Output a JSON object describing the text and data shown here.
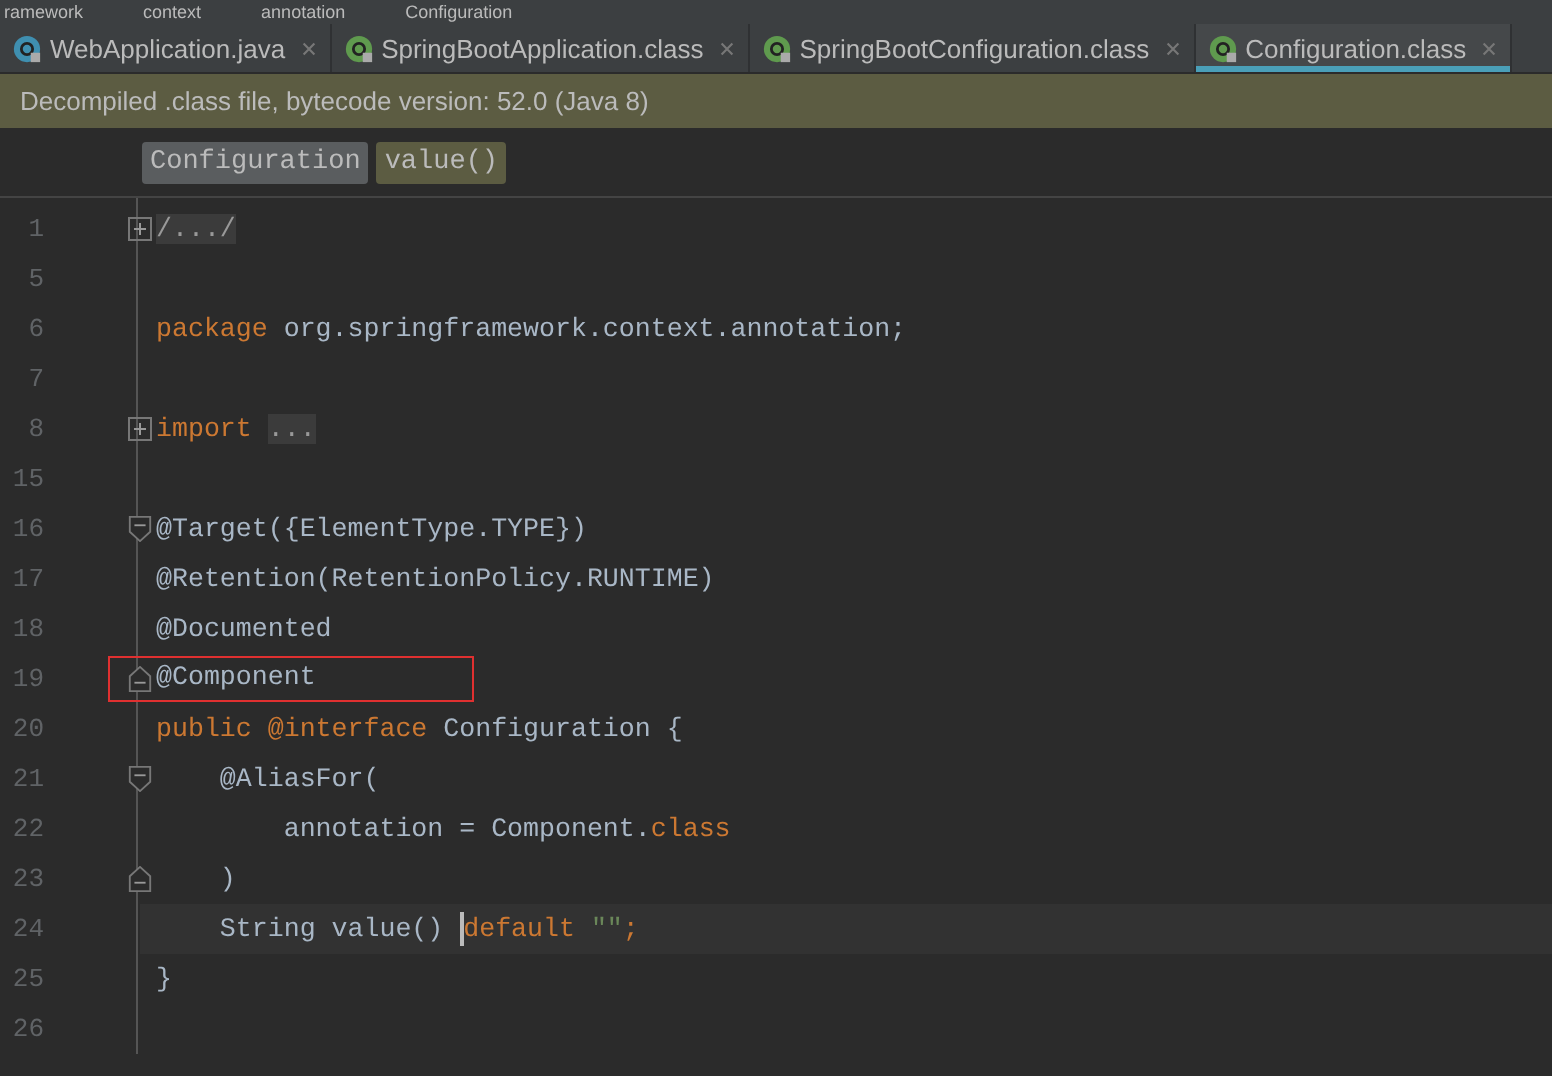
{
  "breadcrumbs": [
    "ramework",
    "context",
    "annotation",
    "Configuration"
  ],
  "tabs": [
    {
      "label": "WebApplication.java",
      "kind": "java",
      "selected": false
    },
    {
      "label": "SpringBootApplication.class",
      "kind": "class",
      "selected": false
    },
    {
      "label": "SpringBootConfiguration.class",
      "kind": "class",
      "selected": false
    },
    {
      "label": "Configuration.class",
      "kind": "class",
      "selected": true
    }
  ],
  "notice": "Decompiled .class file, bytecode version: 52.0 (Java 8)",
  "structure": [
    {
      "label": "Configuration",
      "selected": true
    },
    {
      "label": "value()",
      "selected": false
    }
  ],
  "lines": [
    {
      "number": "1",
      "collapsed": true,
      "fold_start": false,
      "fold_end": false,
      "current": false,
      "marked": false,
      "tokens": [
        {
          "kind": "folded",
          "text": "/.../"
        }
      ]
    },
    {
      "number": "5",
      "collapsed": false,
      "fold_start": false,
      "fold_end": false,
      "current": false,
      "marked": false
    },
    {
      "number": "6",
      "collapsed": false,
      "fold_start": false,
      "fold_end": false,
      "current": false,
      "marked": false,
      "tokens": [
        {
          "kind": "keyword",
          "text": "package "
        },
        {
          "kind": "plain",
          "text": "org.springframework.context.annotation;"
        }
      ]
    },
    {
      "number": "7",
      "collapsed": false,
      "fold_start": false,
      "fold_end": false,
      "current": false,
      "marked": false
    },
    {
      "number": "8",
      "collapsed": true,
      "fold_start": false,
      "fold_end": false,
      "current": false,
      "marked": false,
      "tokens": [
        {
          "kind": "keyword",
          "text": "import "
        },
        {
          "kind": "folded",
          "text": "..."
        }
      ]
    },
    {
      "number": "15",
      "collapsed": false,
      "fold_start": false,
      "fold_end": false,
      "current": false,
      "marked": false
    },
    {
      "number": "16",
      "collapsed": false,
      "fold_start": true,
      "fold_end": false,
      "current": false,
      "marked": false,
      "tokens": [
        {
          "kind": "plain",
          "text": "@Target({ElementType.TYPE})"
        }
      ]
    },
    {
      "number": "17",
      "collapsed": false,
      "fold_start": false,
      "fold_end": false,
      "current": false,
      "marked": false,
      "tokens": [
        {
          "kind": "plain",
          "text": "@Retention(RetentionPolicy.RUNTIME)"
        }
      ]
    },
    {
      "number": "18",
      "collapsed": false,
      "fold_start": false,
      "fold_end": false,
      "current": false,
      "marked": false,
      "tokens": [
        {
          "kind": "plain",
          "text": "@Documented"
        }
      ]
    },
    {
      "number": "19",
      "collapsed": false,
      "fold_start": false,
      "fold_end": true,
      "current": false,
      "marked": true,
      "tokens": [
        {
          "kind": "plain",
          "text": "@Component"
        }
      ]
    },
    {
      "number": "20",
      "collapsed": false,
      "fold_start": false,
      "fold_end": false,
      "current": false,
      "marked": false,
      "tokens": [
        {
          "kind": "keyword",
          "text": "public @interface "
        },
        {
          "kind": "plain",
          "text": "Configuration {"
        }
      ]
    },
    {
      "number": "21",
      "collapsed": false,
      "fold_start": true,
      "fold_end": false,
      "current": false,
      "marked": false,
      "tokens": [
        {
          "kind": "plain",
          "text": "    @AliasFor("
        }
      ]
    },
    {
      "number": "22",
      "collapsed": false,
      "fold_start": false,
      "fold_end": false,
      "current": false,
      "marked": false,
      "tokens": [
        {
          "kind": "plain",
          "text": "        annotation = Component."
        },
        {
          "kind": "keyword",
          "text": "class"
        }
      ]
    },
    {
      "number": "23",
      "collapsed": false,
      "fold_start": false,
      "fold_end": true,
      "current": false,
      "marked": false,
      "tokens": [
        {
          "kind": "plain",
          "text": "    )"
        }
      ]
    },
    {
      "number": "24",
      "collapsed": false,
      "fold_start": false,
      "fold_end": false,
      "current": true,
      "marked": false,
      "tokens": [
        {
          "kind": "plain",
          "text": "    String value() "
        },
        {
          "kind": "keyword",
          "text": "default "
        },
        {
          "kind": "string",
          "text": "\"\""
        },
        {
          "kind": "keyword",
          "text": ";"
        }
      ]
    },
    {
      "number": "25",
      "collapsed": false,
      "fold_start": false,
      "fold_end": false,
      "current": false,
      "marked": false,
      "tokens": [
        {
          "kind": "plain",
          "text": "}"
        }
      ]
    },
    {
      "number": "26",
      "collapsed": false,
      "fold_start": false,
      "fold_end": false,
      "current": false,
      "marked": false
    }
  ]
}
